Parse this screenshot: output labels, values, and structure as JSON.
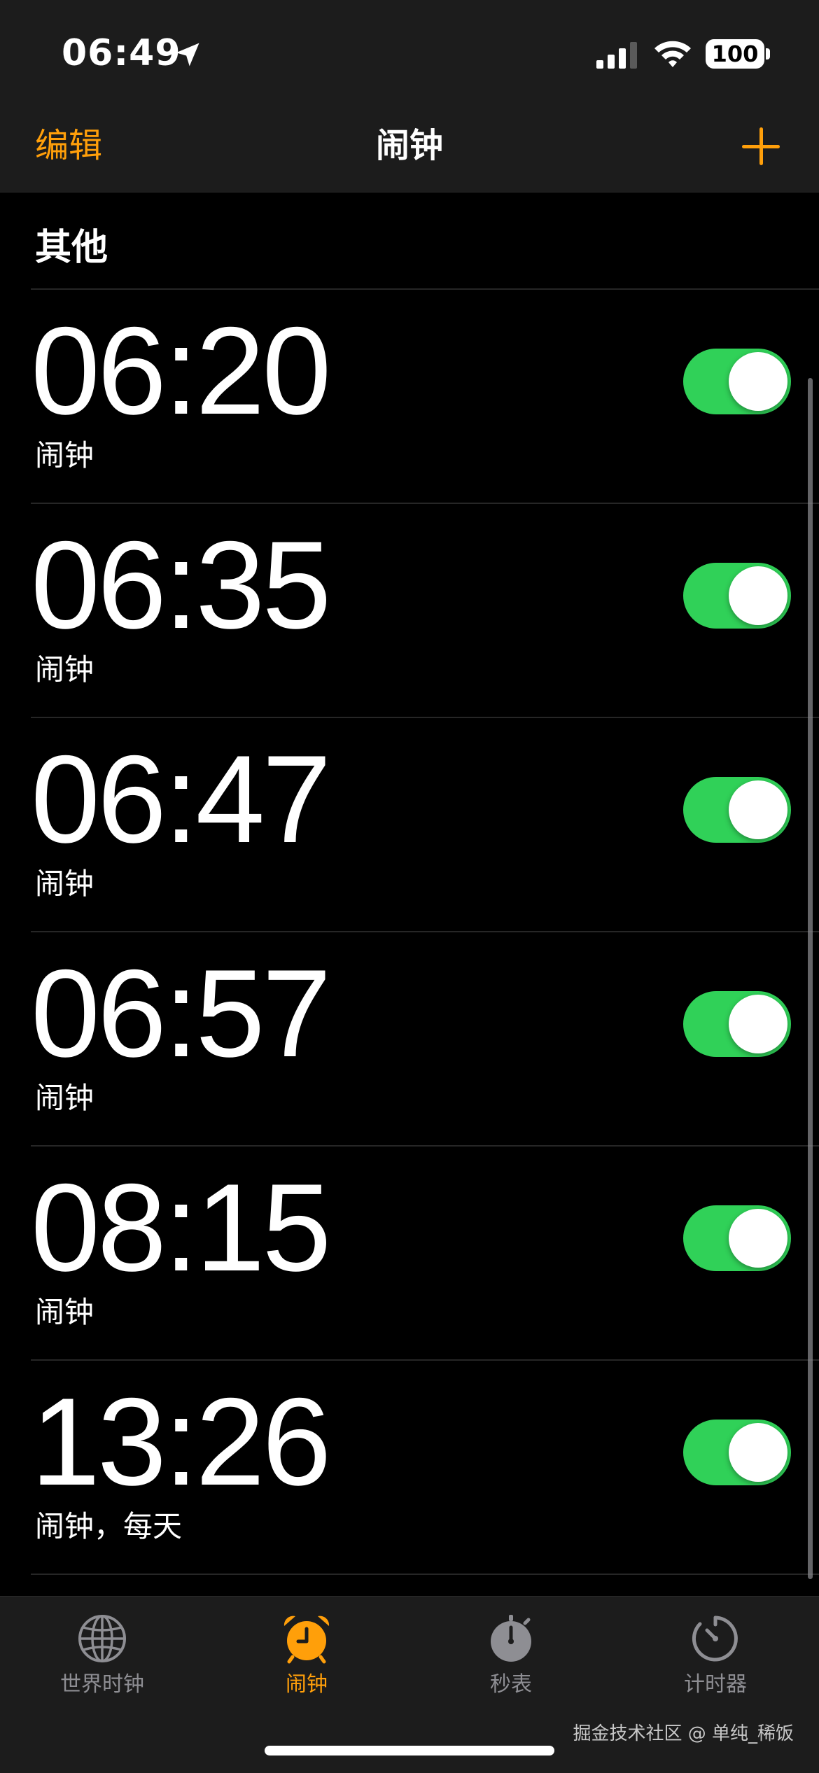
{
  "status_bar": {
    "time": "06:49",
    "battery": "100"
  },
  "nav": {
    "edit_label": "编辑",
    "title": "闹钟",
    "add_icon": "plus-icon"
  },
  "section": {
    "title": "其他"
  },
  "alarms": [
    {
      "time": "06:20",
      "label": "闹钟",
      "enabled": true
    },
    {
      "time": "06:35",
      "label": "闹钟",
      "enabled": true
    },
    {
      "time": "06:47",
      "label": "闹钟",
      "enabled": true
    },
    {
      "time": "06:57",
      "label": "闹钟",
      "enabled": true
    },
    {
      "time": "08:15",
      "label": "闹钟",
      "enabled": true
    },
    {
      "time": "13:26",
      "label": "闹钟，每天",
      "enabled": true
    }
  ],
  "tabs": [
    {
      "label": "世界时钟",
      "icon": "globe-icon",
      "active": false
    },
    {
      "label": "闹钟",
      "icon": "alarm-clock-icon",
      "active": true
    },
    {
      "label": "秒表",
      "icon": "stopwatch-icon",
      "active": false
    },
    {
      "label": "计时器",
      "icon": "timer-icon",
      "active": false
    }
  ],
  "watermark": "掘金技术社区 @ 单纯_稀饭",
  "colors": {
    "accent": "#ff9f0a",
    "toggle_on": "#30d158",
    "background": "#000000",
    "bar_background": "#1c1c1c",
    "inactive_tab": "#8e8e93"
  }
}
